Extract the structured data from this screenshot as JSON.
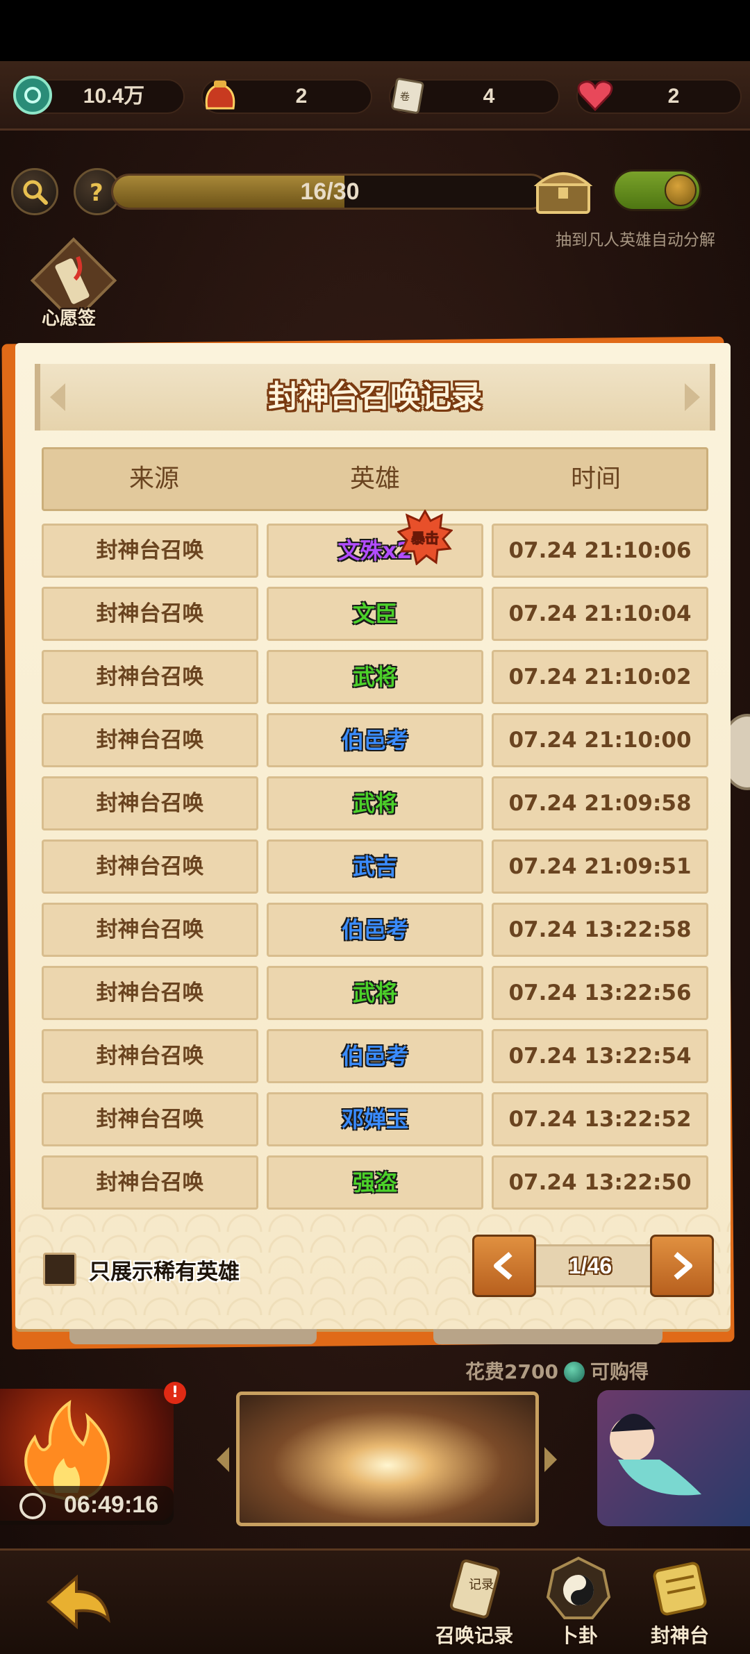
{
  "resources": [
    {
      "icon": "jade-coin-icon",
      "value": "10.4万"
    },
    {
      "icon": "summon-pouch-icon",
      "value": "2"
    },
    {
      "icon": "scroll-ticket-icon",
      "value": "4"
    },
    {
      "icon": "heart-icon",
      "value": "2"
    }
  ],
  "progress": {
    "text": "16/30",
    "fraction": 0.533
  },
  "auto_decompose_label": "抽到凡人英雄自动分解",
  "wish_label": "心愿签",
  "dialog": {
    "title": "封神台召唤记录",
    "columns": [
      "来源",
      "英雄",
      "时间"
    ],
    "crit_badge": "暴击",
    "rows": [
      {
        "source": "封神台召唤",
        "hero": "文殊x2",
        "hero_color": "#b24dff",
        "time": "07.24 21:10:06"
      },
      {
        "source": "封神台召唤",
        "hero": "文臣",
        "hero_color": "#4cd12a",
        "time": "07.24 21:10:04"
      },
      {
        "source": "封神台召唤",
        "hero": "武将",
        "hero_color": "#4cd12a",
        "time": "07.24 21:10:02"
      },
      {
        "source": "封神台召唤",
        "hero": "伯邑考",
        "hero_color": "#3a8cff",
        "time": "07.24 21:10:00"
      },
      {
        "source": "封神台召唤",
        "hero": "武将",
        "hero_color": "#4cd12a",
        "time": "07.24 21:09:58"
      },
      {
        "source": "封神台召唤",
        "hero": "武吉",
        "hero_color": "#3a8cff",
        "time": "07.24 21:09:51"
      },
      {
        "source": "封神台召唤",
        "hero": "伯邑考",
        "hero_color": "#3a8cff",
        "time": "07.24 13:22:58"
      },
      {
        "source": "封神台召唤",
        "hero": "武将",
        "hero_color": "#4cd12a",
        "time": "07.24 13:22:56"
      },
      {
        "source": "封神台召唤",
        "hero": "伯邑考",
        "hero_color": "#3a8cff",
        "time": "07.24 13:22:54"
      },
      {
        "source": "封神台召唤",
        "hero": "邓婵玉",
        "hero_color": "#3a8cff",
        "time": "07.24 13:22:52"
      },
      {
        "source": "封神台召唤",
        "hero": "强盗",
        "hero_color": "#4cd12a",
        "time": "07.24 13:22:50"
      }
    ],
    "rare_only_label": "只展示稀有英雄",
    "page_text": "1/46",
    "prev_label": "<",
    "next_label": ">"
  },
  "cost": {
    "prefix": "花费2700",
    "suffix": "可购得"
  },
  "timer": "06:49:16",
  "notification_badge": "!",
  "tabs": [
    {
      "label": "召唤记录",
      "icon": "record-scroll-icon"
    },
    {
      "label": "卜卦",
      "icon": "yin-yang-icon"
    },
    {
      "label": "封神台",
      "icon": "altar-scroll-icon"
    }
  ],
  "colors": {
    "accent_orange": "#e06a18",
    "panel": "#fbf3dc",
    "green_rarity": "#4cd12a",
    "blue_rarity": "#3a8cff",
    "purple_rarity": "#b24dff"
  }
}
